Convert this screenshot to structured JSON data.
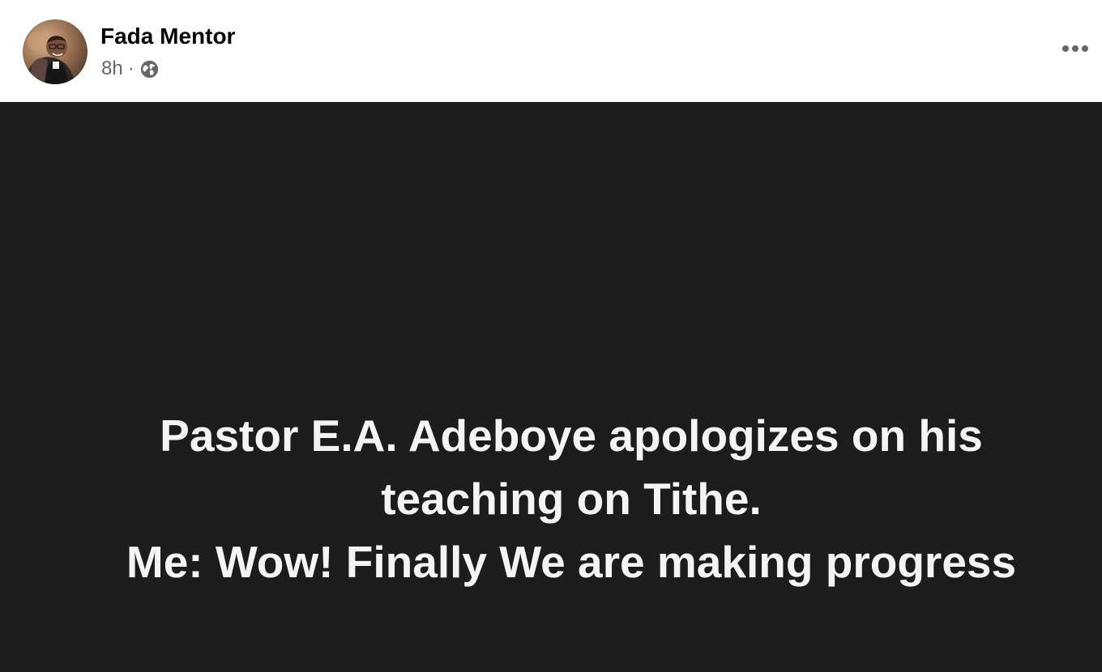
{
  "post": {
    "author": {
      "name": "Fada Mentor"
    },
    "timestamp": "8h",
    "separator": "·",
    "privacy_icon": "globe-icon",
    "more_icon": "ellipsis-icon",
    "text_lines": [
      "Pastor E.A. Adeboye apologizes on his",
      "teaching on Tithe.",
      "Me: Wow! Finally We are making progress"
    ],
    "colors": {
      "header_background": "#ffffff",
      "author_name": "#050505",
      "meta_text": "#65676b",
      "post_background": "#1c1c1c",
      "post_text": "#f4f4f4"
    }
  }
}
